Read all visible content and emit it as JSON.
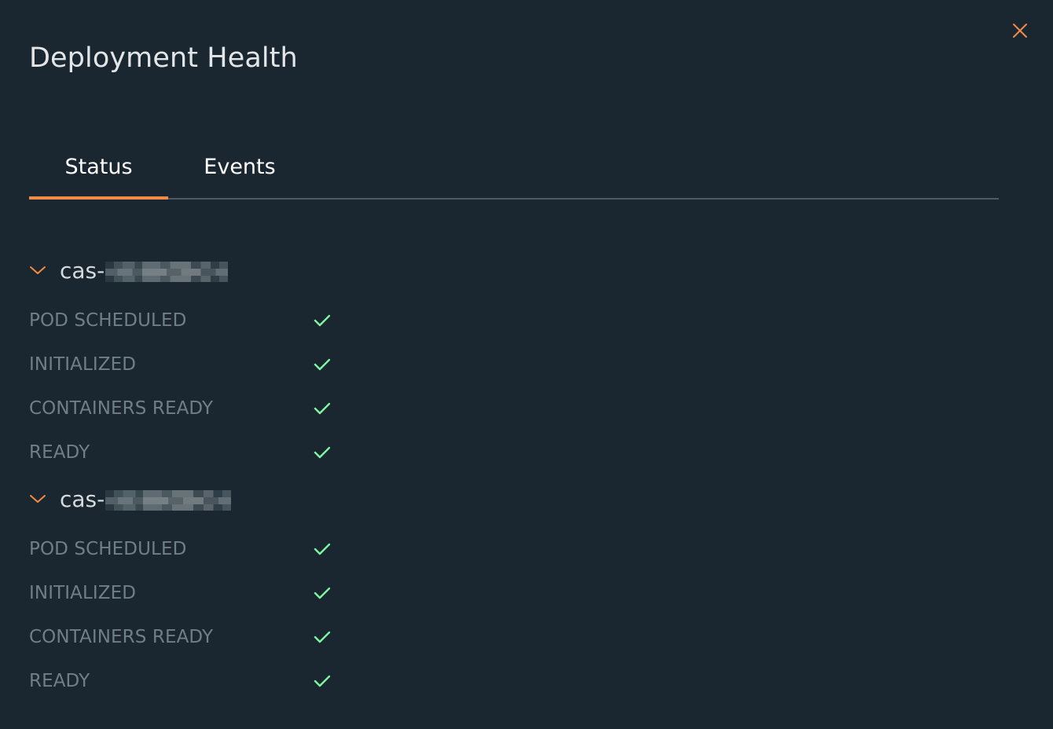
{
  "dialog": {
    "title": "Deployment Health",
    "close_icon": "close-icon",
    "accent_color": "#f08a47",
    "success_color": "#7ff5a0"
  },
  "tabs": [
    {
      "label": "Status",
      "active": true
    },
    {
      "label": "Events",
      "active": false
    }
  ],
  "pods": [
    {
      "name_prefix": "cas-",
      "name_redacted": true,
      "expanded": true,
      "conditions": [
        {
          "label": "POD SCHEDULED",
          "status": "check-icon"
        },
        {
          "label": "INITIALIZED",
          "status": "check-icon"
        },
        {
          "label": "CONTAINERS READY",
          "status": "check-icon"
        },
        {
          "label": "READY",
          "status": "check-icon"
        }
      ]
    },
    {
      "name_prefix": "cas-",
      "name_redacted": true,
      "expanded": true,
      "conditions": [
        {
          "label": "POD SCHEDULED",
          "status": "check-icon"
        },
        {
          "label": "INITIALIZED",
          "status": "check-icon"
        },
        {
          "label": "CONTAINERS READY",
          "status": "check-icon"
        },
        {
          "label": "READY",
          "status": "check-icon"
        }
      ]
    }
  ]
}
